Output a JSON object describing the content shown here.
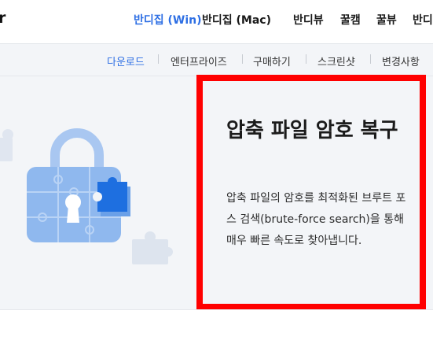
{
  "header": {
    "logo_fragment": "r",
    "nav": [
      {
        "label": "반디집 (Win)",
        "active": true
      },
      {
        "label": "반디집 (Mac)",
        "active": false
      },
      {
        "label": "반디뷰",
        "active": false
      },
      {
        "label": "꿀캠",
        "active": false
      },
      {
        "label": "꿀뷰",
        "active": false
      },
      {
        "label": "반디",
        "active": false
      }
    ]
  },
  "subnav": [
    {
      "label": "다운로드",
      "active": true
    },
    {
      "label": "엔터프라이즈",
      "active": false
    },
    {
      "label": "구매하기",
      "active": false
    },
    {
      "label": "스크린샷",
      "active": false
    },
    {
      "label": "변경사항",
      "active": false
    }
  ],
  "feature": {
    "title": "압축 파일 암호 복구",
    "description": "압축 파일의 암호를 최적화된 브루트 포스 검색(brute-force search)을 통해 매우 빠른 속도로 찾아냅니다.",
    "illustration_icon": "puzzle-lock-icon",
    "highlight_color": "#ff0000",
    "accent_color": "#2e6fe4"
  }
}
